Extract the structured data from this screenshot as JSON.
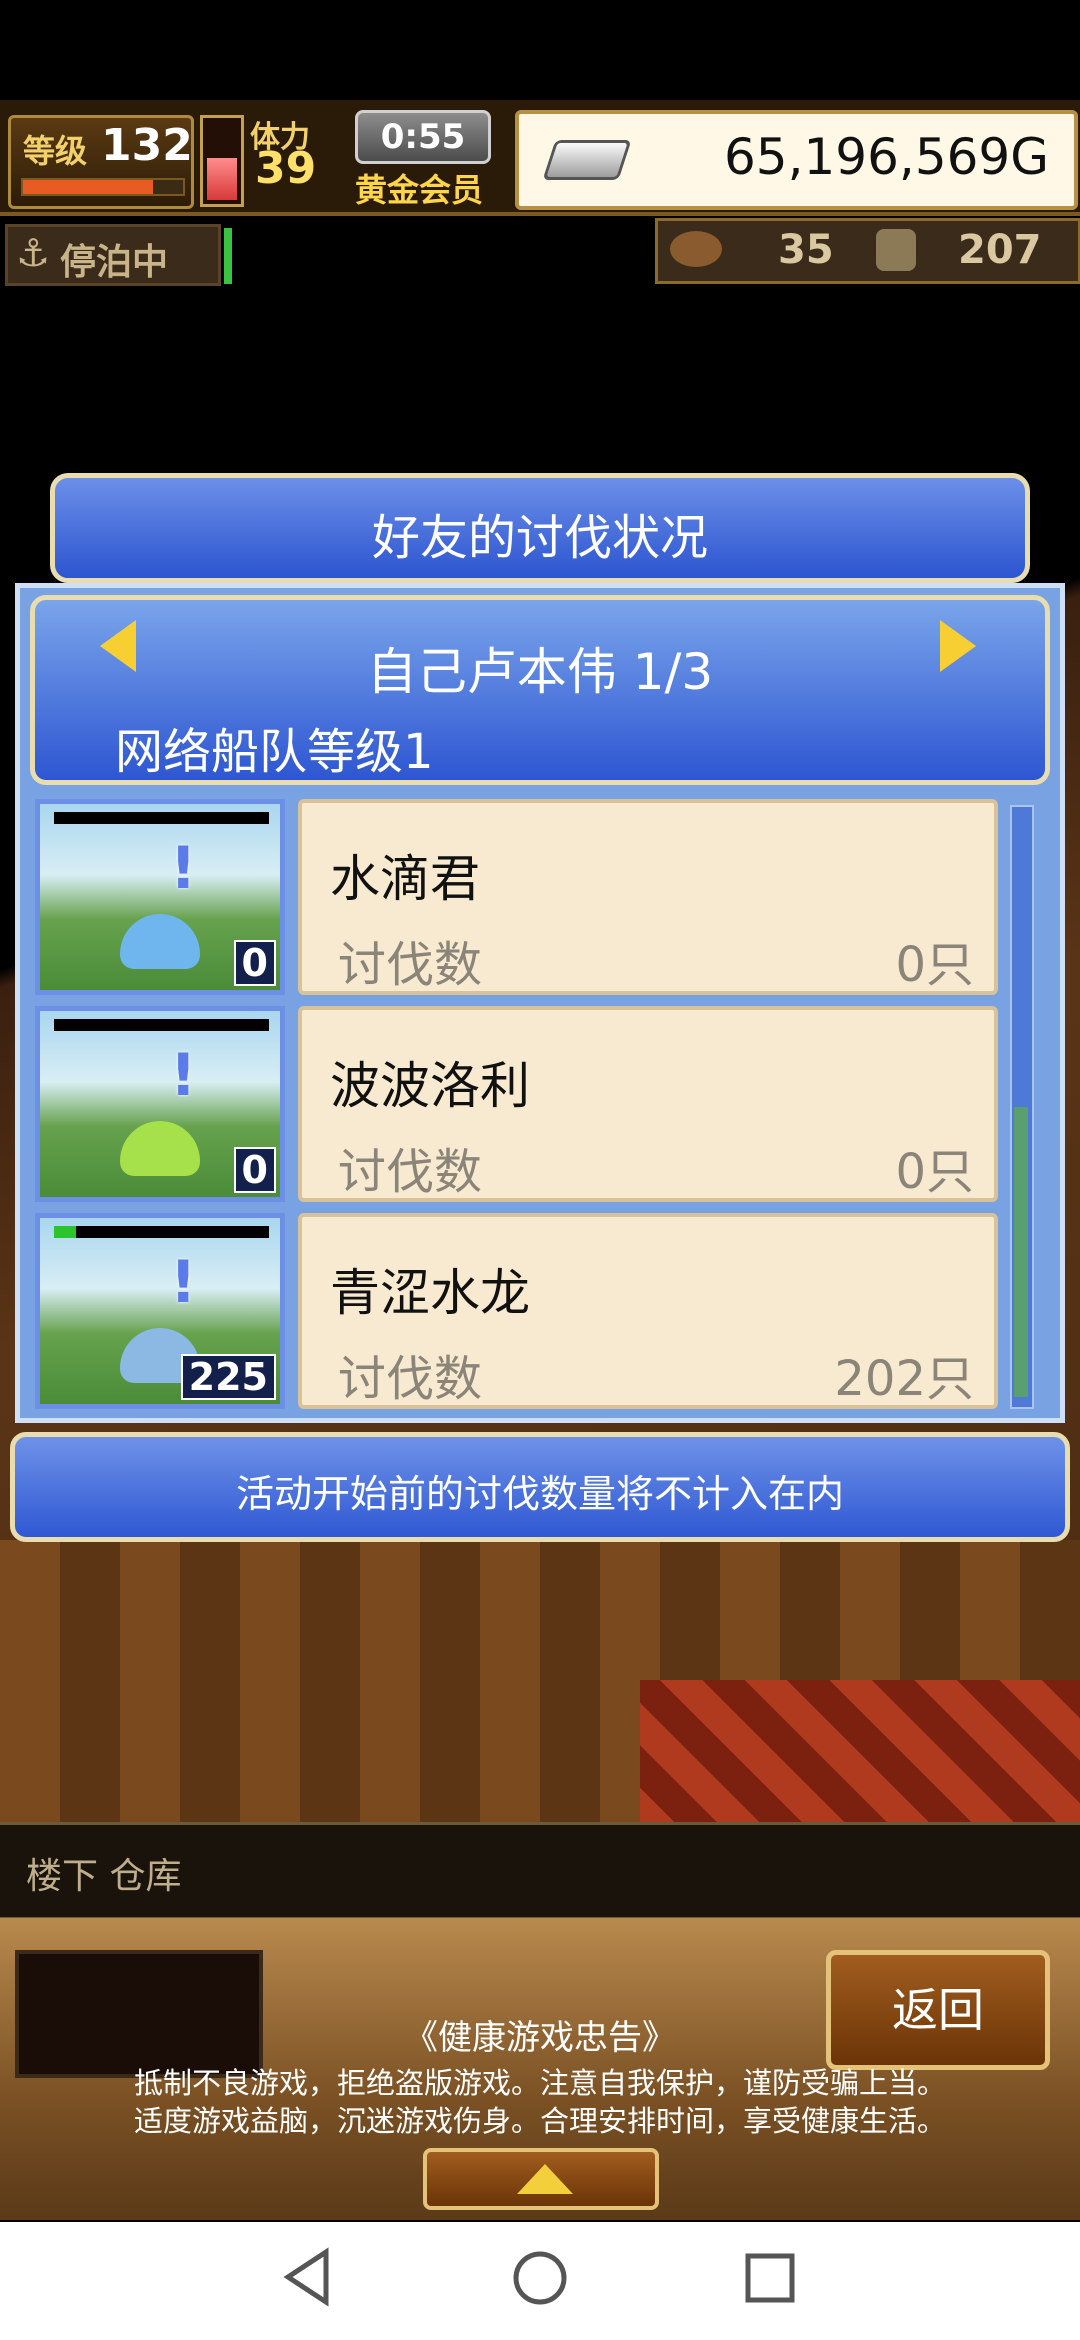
{
  "hud": {
    "level_label": "等级",
    "level": "132",
    "stamina_label": "体力",
    "stamina": "39",
    "timer": "0:55",
    "membership": "黄金会员",
    "gold": "65,196,569G",
    "dock_status": "停泊中",
    "food": "35",
    "wood": "207"
  },
  "dialog": {
    "title": "好友的讨伐状况",
    "player": "自己卢本伟 1/3",
    "fleet_level": "网络船队等级1",
    "notice": "活动开始前的讨伐数量将不计入在内",
    "rows": [
      {
        "name": "水滴君",
        "kill_label": "讨伐数",
        "kills": "0只",
        "count_badge": "0",
        "monster_color": "#6fb6ee",
        "hp_fraction": 0
      },
      {
        "name": "波波洛利",
        "kill_label": "讨伐数",
        "kills": "0只",
        "count_badge": "0",
        "monster_color": "#a6e04a",
        "hp_fraction": 0
      },
      {
        "name": "青涩水龙",
        "kill_label": "讨伐数",
        "kills": "202只",
        "count_badge": "225",
        "monster_color": "#8cb9e3",
        "hp_fraction": 0.1
      }
    ]
  },
  "bottom": {
    "location": "楼下 仓库",
    "back_button": "返回",
    "advisory_title": "《健康游戏忠告》",
    "advisory_line1": "抵制不良游戏，拒绝盗版游戏。注意自我保护，谨防受骗上当。",
    "advisory_line2": "适度游戏益脑，沉迷游戏伤身。合理安排时间，享受健康生活。"
  },
  "icons": {
    "anchor": "anchor-icon",
    "gold": "silver-ingot-icon",
    "food": "food-icon",
    "wood": "wood-icon"
  }
}
